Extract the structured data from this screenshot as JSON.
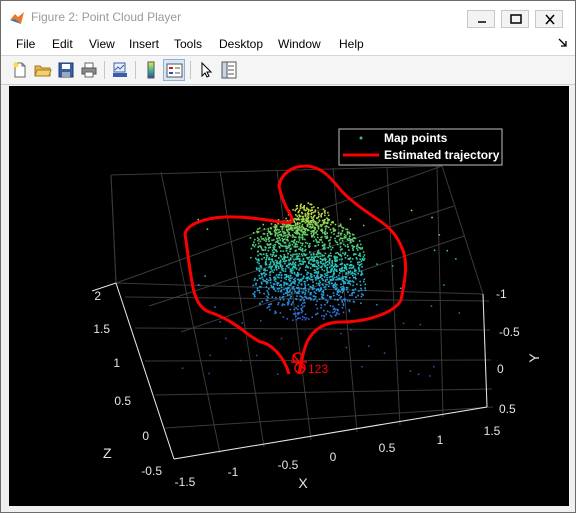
{
  "window": {
    "title": "Figure 2: Point Cloud Player"
  },
  "menu": {
    "items": [
      "File",
      "Edit",
      "View",
      "Insert",
      "Tools",
      "Desktop",
      "Window",
      "Help"
    ]
  },
  "toolbar": {
    "buttons": [
      "new-figure-icon",
      "open-file-icon",
      "save-icon",
      "print-icon",
      "link-plot-icon",
      "insert-colorbar-icon",
      "insert-legend-icon",
      "edit-plot-icon",
      "property-inspector-icon"
    ]
  },
  "plot": {
    "legend": {
      "map_points_label": "Map points",
      "trajectory_label": "Estimated trajectory"
    },
    "annotation": "123",
    "axes": {
      "x": {
        "label": "X",
        "ticks": [
          "-1.5",
          "-1",
          "-0.5",
          "0",
          "0.5",
          "1",
          "1.5"
        ]
      },
      "y": {
        "label": "Y",
        "ticks": [
          "-1",
          "-0.5",
          "0",
          "0.5"
        ]
      },
      "z": {
        "label": "Z",
        "ticks": [
          "-0.5",
          "0",
          "0.5",
          "1",
          "1.5",
          "2"
        ]
      }
    },
    "colors": {
      "background": "#000000",
      "trajectory": "#ff0000",
      "grid": "#3a3a3a"
    }
  }
}
